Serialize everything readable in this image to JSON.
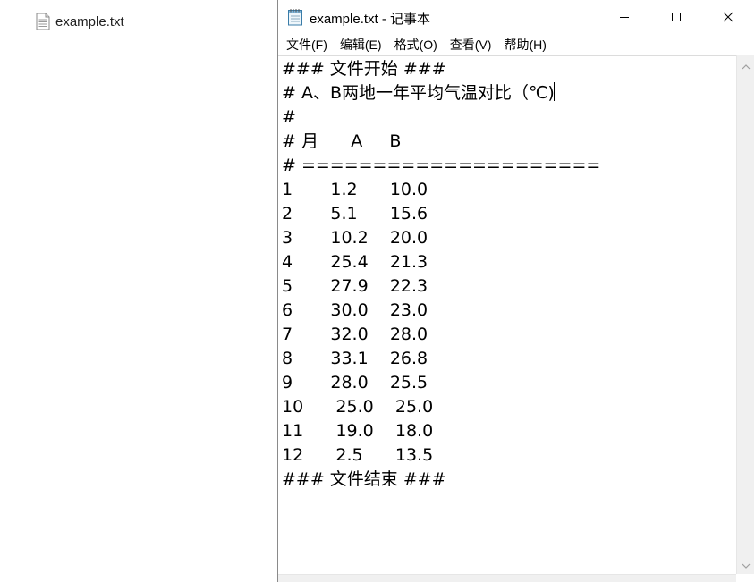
{
  "desktop": {
    "file_name": "example.txt"
  },
  "window": {
    "title": "example.txt - 记事本",
    "menu": [
      {
        "label": "文件(F)"
      },
      {
        "label": "编辑(E)"
      },
      {
        "label": "格式(O)"
      },
      {
        "label": "查看(V)"
      },
      {
        "label": "帮助(H)"
      }
    ]
  },
  "editor": {
    "lines": [
      "### 文件开始 ###",
      "# A、B两地一年平均气温对比（℃)",
      "#",
      "# 月      A     B",
      "# =====================",
      "1       1.2      10.0",
      "2       5.1      15.6",
      "3       10.2    20.0",
      "4       25.4    21.3",
      "5       27.9    22.3",
      "6       30.0    23.0",
      "7       32.0    28.0",
      "8       33.1    26.8",
      "9       28.0    25.5",
      "10      25.0    25.0",
      "11      19.0    18.0",
      "12      2.5      13.5",
      "### 文件结束 ###"
    ]
  },
  "icons": {
    "file": "text-file-icon",
    "app": "notepad-icon",
    "minimize": "minimize-icon",
    "maximize": "maximize-icon",
    "close": "close-icon"
  },
  "colors": {
    "window_border": "#8a8a8a",
    "scrollbar": "#f0f0f0"
  }
}
